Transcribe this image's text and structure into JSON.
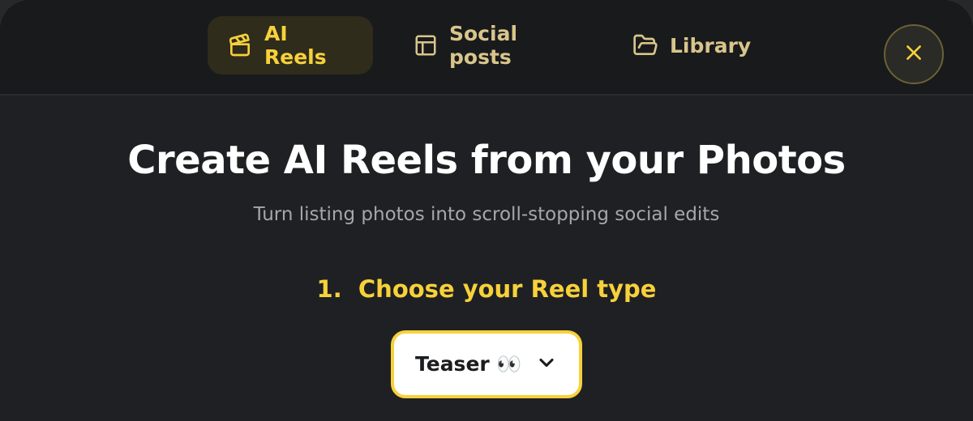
{
  "tabs": [
    {
      "label": "AI Reels",
      "icon": "clapperboard-icon",
      "active": true
    },
    {
      "label": "Social posts",
      "icon": "layout-icon",
      "active": false
    },
    {
      "label": "Library",
      "icon": "folder-open-icon",
      "active": false
    }
  ],
  "close": {
    "icon": "close-icon"
  },
  "main": {
    "title": "Create AI Reels from your Photos",
    "subtitle": "Turn listing photos into scroll-stopping social edits",
    "step_label": "1.  Choose your Reel type",
    "reel_type": {
      "value": "Teaser 👀",
      "icon": "chevron-down-icon"
    }
  },
  "colors": {
    "accent": "#f7d13a",
    "background": "#1f2023",
    "header": "#191a1c",
    "tab_inactive": "#d8c58a"
  }
}
